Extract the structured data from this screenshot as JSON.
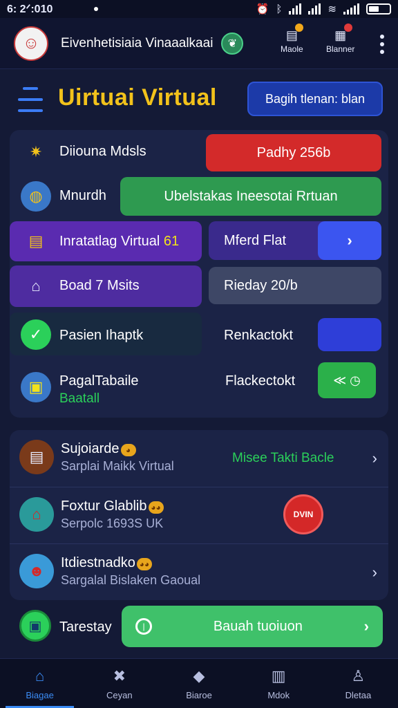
{
  "status_bar": {
    "time": "6: 2ᐟ:010"
  },
  "header": {
    "app_name": "Eivenhetisiaia Vinaaalkaai",
    "leaf_badge_icon": "leaf-icon",
    "actions": [
      {
        "label": "Maole",
        "icon": "notification-icon",
        "pip_color": "#f2a81b"
      },
      {
        "label": "Blanner",
        "icon": "tray-icon",
        "pip_color": "#e03a3a"
      }
    ]
  },
  "title_row": {
    "title": "Uirtuai Virtual",
    "button_label": "Bagih tlenan: blan"
  },
  "panel": {
    "rows": [
      {
        "label": "Diiouna Mdsls",
        "pill": "Padhy 256b",
        "icon": "sparkle-icon"
      },
      {
        "label": "Mnurdh",
        "pill": "Ubelstakas Ineesotai Rrtuan",
        "icon": "globe-icon"
      },
      {
        "label": "Inratatlag Virtual",
        "label_accent": "61",
        "pill": "Mferd Flat",
        "icon": "document-icon"
      },
      {
        "label": "Boad 7 Msits",
        "pill": "Rieday 20/b",
        "icon": "bank-icon"
      },
      {
        "label": "Pasien Ihaptk",
        "pill": "Renkactokt",
        "icon": "check-icon"
      },
      {
        "label": "PagalTabaile",
        "sub": "Baatall",
        "pill": "Flackectokt",
        "icon": "card-icon"
      }
    ]
  },
  "list": [
    {
      "title": "Sujoiarde",
      "sub": "Sarplai Maikk Virtual",
      "right_text": "Misee Takti Bacle",
      "icon": "stack-icon"
    },
    {
      "title": "Foxtur Glablib",
      "sub": "Serpolc 1693S UK",
      "stamp": "DVIN",
      "icon": "building-icon"
    },
    {
      "title": "Itdiestnadko",
      "sub": "Sargalal Bislaken Gaoual",
      "icon": "person-icon"
    }
  ],
  "bottom_row": {
    "label": "Tarestay",
    "button_label": "Bauah tuoiuon"
  },
  "tabs": [
    {
      "label": "Biagae",
      "icon": "home-icon",
      "active": true
    },
    {
      "label": "Ceyan",
      "icon": "tools-icon"
    },
    {
      "label": "Biaroe",
      "icon": "tag-icon"
    },
    {
      "label": "Mdok",
      "icon": "shop-icon"
    },
    {
      "label": "Dletaa",
      "icon": "profile-icon"
    }
  ],
  "colors": {
    "background": "#141a36",
    "title": "#f2c21b",
    "red_pill": "#d32a2a",
    "green_pill": "#2e9a50",
    "purple": "#5a2bb0",
    "blue_button": "#3b55f0",
    "accent_green": "#2bd05a"
  }
}
